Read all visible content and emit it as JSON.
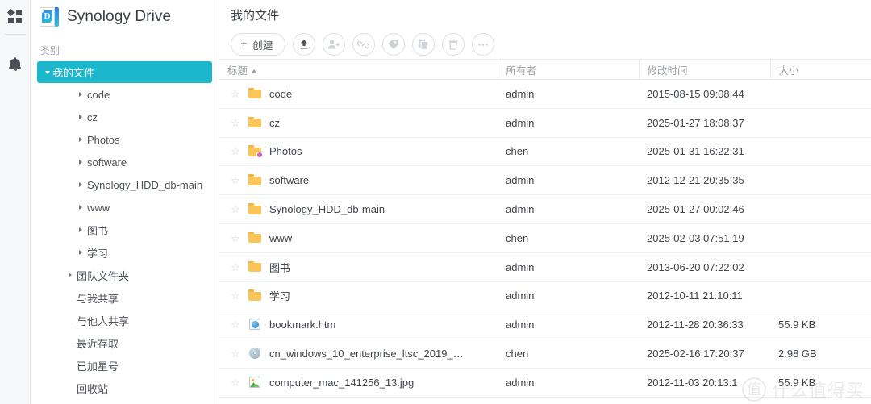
{
  "rail": {
    "items": [
      {
        "icon": "app-grid-icon",
        "name": "app-menu"
      },
      {
        "icon": "bell-icon",
        "name": "notifications"
      }
    ]
  },
  "sidebar": {
    "brand": {
      "logo": "synology-drive-logo",
      "title": "Synology Drive"
    },
    "category_label": "类别",
    "selected": "我的文件",
    "tree": [
      {
        "label": "我的文件",
        "level": 0,
        "caret": "down",
        "selected": true
      },
      {
        "label": "code",
        "level": 2,
        "caret": "right",
        "selected": false
      },
      {
        "label": "cz",
        "level": 2,
        "caret": "right",
        "selected": false
      },
      {
        "label": "Photos",
        "level": 2,
        "caret": "right",
        "selected": false
      },
      {
        "label": "software",
        "level": 2,
        "caret": "right",
        "selected": false
      },
      {
        "label": "Synology_HDD_db-main",
        "level": 2,
        "caret": "right",
        "selected": false
      },
      {
        "label": "www",
        "level": 2,
        "caret": "right",
        "selected": false
      },
      {
        "label": "图书",
        "level": 2,
        "caret": "right",
        "selected": false
      },
      {
        "label": "学习",
        "level": 2,
        "caret": "right",
        "selected": false
      },
      {
        "label": "团队文件夹",
        "level": 1,
        "caret": "right",
        "selected": false
      },
      {
        "label": "与我共享",
        "level": 1,
        "caret": "none",
        "selected": false
      },
      {
        "label": "与他人共享",
        "level": 1,
        "caret": "none",
        "selected": false
      },
      {
        "label": "最近存取",
        "level": 1,
        "caret": "none",
        "selected": false
      },
      {
        "label": "已加星号",
        "level": 1,
        "caret": "none",
        "selected": false
      },
      {
        "label": "回收站",
        "level": 1,
        "caret": "none",
        "selected": false
      }
    ]
  },
  "main": {
    "page_title": "我的文件",
    "toolbar": {
      "create_label": "创建",
      "create_plus": "+",
      "buttons": [
        {
          "name": "upload-button",
          "icon": "upload-icon",
          "enabled": true
        },
        {
          "name": "share-with-user-button",
          "icon": "add-person-icon",
          "enabled": false
        },
        {
          "name": "share-link-button",
          "icon": "link-icon",
          "enabled": false
        },
        {
          "name": "label-button",
          "icon": "tag-icon",
          "enabled": false
        },
        {
          "name": "copy-button",
          "icon": "copy-icon",
          "enabled": false
        },
        {
          "name": "delete-button",
          "icon": "trash-icon",
          "enabled": false
        },
        {
          "name": "more-button",
          "icon": "ellipsis-icon",
          "enabled": false
        }
      ]
    },
    "columns": [
      {
        "key": "title",
        "label": "标题",
        "sort": "asc"
      },
      {
        "key": "owner",
        "label": "所有者",
        "sort": "none"
      },
      {
        "key": "time",
        "label": "修改时间",
        "sort": "none"
      },
      {
        "key": "size",
        "label": "大小",
        "sort": "none"
      }
    ],
    "rows": [
      {
        "name": "code",
        "icon": "folder-icon",
        "owner": "admin",
        "time": "2015-08-15 09:08:44",
        "size": "",
        "starred": false
      },
      {
        "name": "cz",
        "icon": "folder-icon",
        "owner": "admin",
        "time": "2025-01-27 18:08:37",
        "size": "",
        "starred": false
      },
      {
        "name": "Photos",
        "icon": "folder-shared-icon",
        "owner": "chen",
        "time": "2025-01-31 16:22:31",
        "size": "",
        "starred": false
      },
      {
        "name": "software",
        "icon": "folder-icon",
        "owner": "admin",
        "time": "2012-12-21 20:35:35",
        "size": "",
        "starred": false
      },
      {
        "name": "Synology_HDD_db-main",
        "icon": "folder-icon",
        "owner": "admin",
        "time": "2025-01-27 00:02:46",
        "size": "",
        "starred": false
      },
      {
        "name": "www",
        "icon": "folder-icon",
        "owner": "chen",
        "time": "2025-02-03 07:51:19",
        "size": "",
        "starred": false
      },
      {
        "name": "图书",
        "icon": "folder-icon",
        "owner": "admin",
        "time": "2013-06-20 07:22:02",
        "size": "",
        "starred": false
      },
      {
        "name": "学习",
        "icon": "folder-icon",
        "owner": "admin",
        "time": "2012-10-11 21:10:11",
        "size": "",
        "starred": false
      },
      {
        "name": "bookmark.htm",
        "icon": "html-file-icon",
        "owner": "admin",
        "time": "2012-11-28 20:36:33",
        "size": "55.9 KB",
        "starred": false
      },
      {
        "name": "cn_windows_10_enterprise_ltsc_2019_…",
        "icon": "disc-image-icon",
        "owner": "chen",
        "time": "2025-02-16 17:20:37",
        "size": "2.98 GB",
        "starred": false
      },
      {
        "name": "computer_mac_141256_13.jpg",
        "icon": "image-file-icon",
        "owner": "admin",
        "time": "2012-11-03 20:13:1",
        "size": "55.9 KB",
        "starred": false
      }
    ]
  },
  "watermark": {
    "mark": "值",
    "text": "什么值得买"
  },
  "colors": {
    "accent": "#1bb8cd",
    "folder": "#fbc55a",
    "text": "#3f444a",
    "muted": "#9b9fa4"
  }
}
